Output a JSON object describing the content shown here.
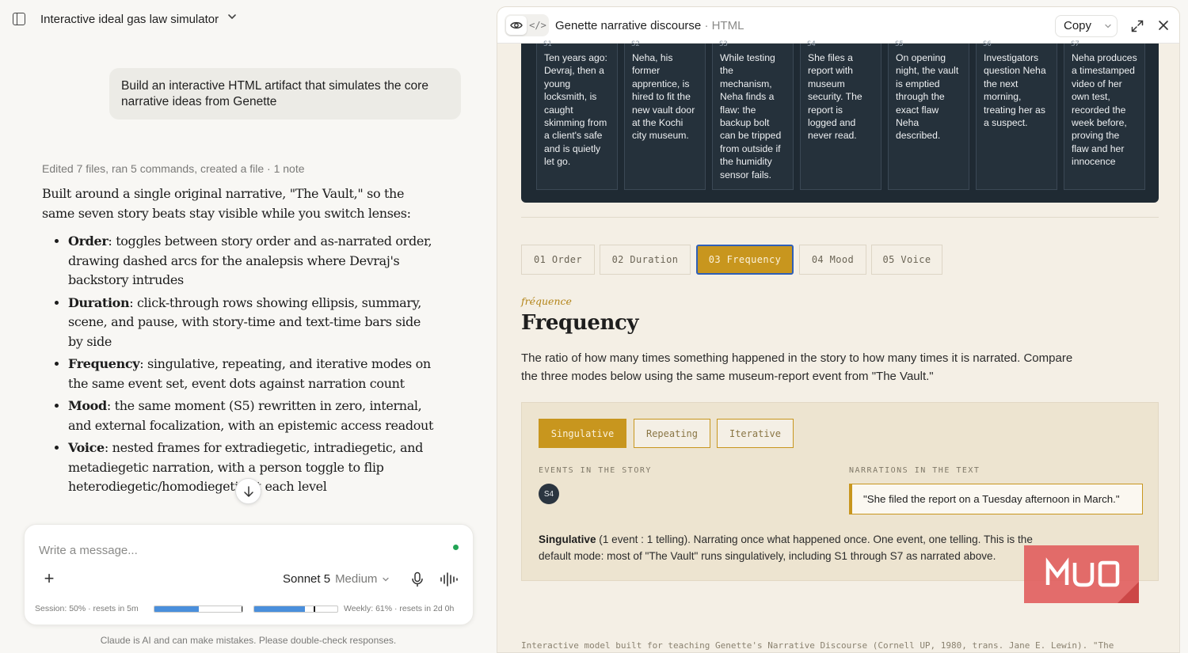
{
  "chat": {
    "title": "Interactive ideal gas law simulator",
    "user_message": "Build an interactive HTML artifact that simulates the core narrative ideas from Genette",
    "activity": "Edited 7 files, ran 5 commands, created a file · 1 note",
    "intro": "Built around a single original narrative, \"The Vault,\" so the same seven story beats stay visible while you switch lenses:",
    "bullets": [
      {
        "term": "Order",
        "text": ": toggles between story order and as-narrated order, drawing dashed arcs for the analepsis where Devraj's backstory intrudes"
      },
      {
        "term": "Duration",
        "text": ": click-through rows showing ellipsis, summary, scene, and pause, with story-time and text-time bars side by side"
      },
      {
        "term": "Frequency",
        "text": ": singulative, repeating, and iterative modes on the same event set, event dots against narration count"
      },
      {
        "term": "Mood",
        "text": ": the same moment (S5) rewritten in zero, internal, and external focalization, with an epistemic access readout"
      },
      {
        "term": "Voice",
        "text": ": nested frames for extradiegetic, intradiegetic, and metadiegetic narration, with a person toggle to flip heterodiegetic/homodiegetic at each level"
      }
    ]
  },
  "composer": {
    "placeholder": "Write a message...",
    "model": "Sonnet 5",
    "effort": "Medium",
    "session_usage": "Session: 50% · resets in 5m",
    "session_fraction": 0.5,
    "weekly_usage": "Weekly: 61% · resets in 2d 0h",
    "weekly_fraction": 0.61,
    "status_color": "#22a455"
  },
  "disclaimer": "Claude is AI and can make mistakes. Please double-check responses.",
  "artifact": {
    "title": "Genette narrative discourse",
    "type": "· HTML",
    "copy_label": "Copy",
    "beats": [
      {
        "id": "S1",
        "text": "Ten years ago: Devraj, then a young locksmith, is caught skimming from a client's safe and is quietly let go."
      },
      {
        "id": "S2",
        "text": "Neha, his former apprentice, is hired to fit the new vault door at the Kochi city museum."
      },
      {
        "id": "S3",
        "text": "While testing the mechanism, Neha finds a flaw: the backup bolt can be tripped from outside if the humidity sensor fails."
      },
      {
        "id": "S4",
        "text": "She files a report with museum security. The report is logged and never read."
      },
      {
        "id": "S5",
        "text": "On opening night, the vault is emptied through the exact flaw Neha described."
      },
      {
        "id": "S6",
        "text": "Investigators question Neha the next morning, treating her as a suspect."
      },
      {
        "id": "S7",
        "text": "Neha produces a timestamped video of her own test, recorded the week before, proving the flaw and her innocence"
      }
    ],
    "lenses": [
      "01 Order",
      "02 Duration",
      "03 Frequency",
      "04 Mood",
      "05 Voice"
    ],
    "active_lens": "03 Frequency",
    "lens_kicker": "fréquence",
    "lens_heading": "Frequency",
    "lens_description": "The ratio of how many times something happened in the story to how many times it is narrated. Compare the three modes below using the same museum-report event from \"The Vault.\"",
    "modes": [
      "Singulative",
      "Repeating",
      "Iterative"
    ],
    "active_mode": "Singulative",
    "events_label": "EVENTS IN THE STORY",
    "narrations_label": "NARRATIONS IN THE TEXT",
    "event_dot": "S4",
    "narration": "\"She filed the report on a Tuesday afternoon in March.\"",
    "explanation_term": "Singulative",
    "explanation_text": " (1 event : 1 telling). Narrating once what happened once. One event, one telling. This is the default mode: most of \"The Vault\" runs singulatively, including S1 through S7 as narrated above.",
    "footer": "Interactive model built for teaching Genette's Narrative Discourse (Cornell UP, 1980, trans. Jane E. Lewin). \"The",
    "accent_color": "#c8961e",
    "timeline_color": "#1f2a33"
  },
  "watermark": {
    "text": "MUO",
    "color": "#e05a5a"
  }
}
